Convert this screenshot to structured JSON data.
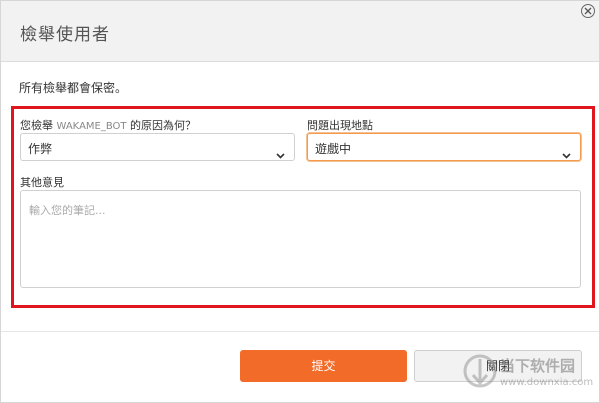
{
  "dialog": {
    "title": "檢舉使用者",
    "notice": "所有檢舉都會保密。"
  },
  "form": {
    "reason_label_prefix": "您檢舉",
    "reason_label_user": "WAKAME_BOT",
    "reason_label_suffix": "的原因為何？",
    "reason_value": "作弊",
    "location_label": "問題出現地點",
    "location_value": "遊戲中",
    "comments_label": "其他意見",
    "comments_placeholder": "輸入您的筆記..."
  },
  "footer": {
    "submit_label": "提交",
    "close_label": "關閉"
  },
  "watermark": {
    "text": "当下软件园",
    "url": "www.downxia.com"
  },
  "colors": {
    "accent": "#f26b29",
    "highlight_frame": "#e0161e",
    "focus_border": "#f39a4e"
  },
  "icons": {
    "close": "close-icon",
    "dropdown": "chevron-down-icon"
  }
}
